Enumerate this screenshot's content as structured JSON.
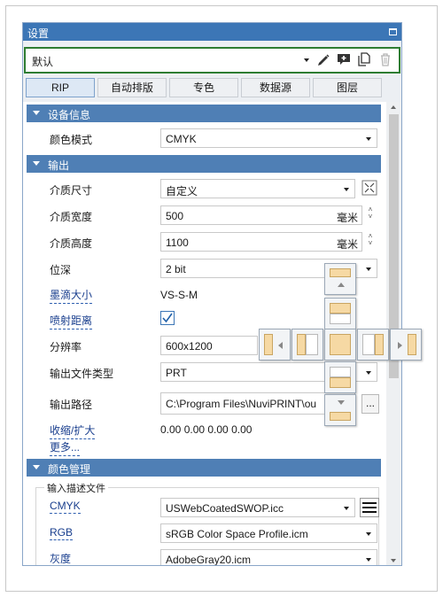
{
  "window": {
    "title": "设置"
  },
  "preset": {
    "value": "默认"
  },
  "toolbar": {
    "icons": [
      "edit-icon",
      "add-icon",
      "copy-icon",
      "delete-icon"
    ]
  },
  "tabs": [
    {
      "label": "RIP",
      "active": true
    },
    {
      "label": "自动排版",
      "active": false
    },
    {
      "label": "专色",
      "active": false
    },
    {
      "label": "数据源",
      "active": false
    },
    {
      "label": "图层",
      "active": false
    }
  ],
  "device_info": {
    "header": "设备信息",
    "color_mode_label": "颜色模式",
    "color_mode_value": "CMYK"
  },
  "output": {
    "header": "输出",
    "media_size_label": "介质尺寸",
    "media_size_value": "自定义",
    "media_width_label": "介质宽度",
    "media_width_value": "500",
    "media_width_unit": "毫米",
    "media_height_label": "介质高度",
    "media_height_value": "1100",
    "media_height_unit": "毫米",
    "bit_depth_label": "位深",
    "bit_depth_value": "2 bit",
    "drop_size_label": "墨滴大小",
    "drop_size_value": "VS-S-M",
    "jet_distance_label": "喷射距离",
    "resolution_label": "分辨率",
    "resolution_value": "600x1200",
    "file_type_label": "输出文件类型",
    "file_type_value": "PRT",
    "path_label": "输出路径",
    "path_value": "C:\\Program Files\\NuviPRINT\\ou",
    "path_button": "...",
    "scale_label": "收缩/扩大",
    "scale_value": "0.00 0.00 0.00 0.00",
    "more_label": "更多..."
  },
  "color_mgmt": {
    "header": "颜色管理",
    "group_label": "输入描述文件",
    "cmyk_label": "CMYK",
    "cmyk_value": "USWebCoatedSWOP.icc",
    "rgb_label": "RGB",
    "rgb_value": "sRGB Color Space Profile.icm",
    "gray_label": "灰度",
    "gray_value": "AdobeGray20.icm"
  },
  "colors": {
    "titlebar": "#3c76b6",
    "section": "#4f7fb5",
    "preset_border": "#2e7d32",
    "link": "#1a3f8e",
    "dock_fill": "#f6d9a4"
  }
}
